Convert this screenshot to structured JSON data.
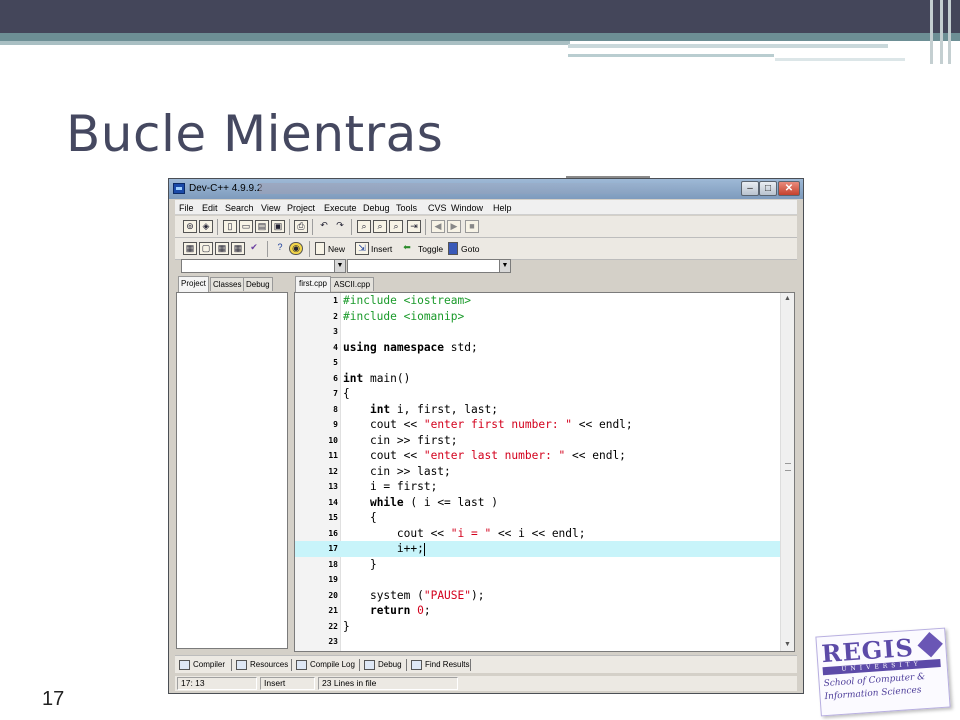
{
  "slide": {
    "title": "Bucle Mientras",
    "number": "17"
  },
  "window": {
    "title": "Dev-C++ 4.9.9.2",
    "buttons": {
      "minimize": "–",
      "maximize": "□",
      "close": "✕"
    }
  },
  "menu": [
    "File",
    "Edit",
    "Search",
    "View",
    "Project",
    "Execute",
    "Debug",
    "Tools",
    "CVS",
    "Window",
    "Help"
  ],
  "toolbar2": {
    "new_label": "New",
    "insert_label": "Insert",
    "toggle_label": "Toggle",
    "goto_label": "Goto"
  },
  "left_tabs": [
    "Project",
    "Classes",
    "Debug"
  ],
  "file_tabs": [
    "first.cpp",
    "ASCII.cpp"
  ],
  "code_lines": [
    {
      "n": "1"
    },
    {
      "n": "2"
    },
    {
      "n": "3"
    },
    {
      "n": "4"
    },
    {
      "n": "5"
    },
    {
      "n": "6"
    },
    {
      "n": "7"
    },
    {
      "n": "8"
    },
    {
      "n": "9"
    },
    {
      "n": "10"
    },
    {
      "n": "11"
    },
    {
      "n": "12"
    },
    {
      "n": "13"
    },
    {
      "n": "14"
    },
    {
      "n": "15"
    },
    {
      "n": "16"
    },
    {
      "n": "17"
    },
    {
      "n": "18"
    },
    {
      "n": "19"
    },
    {
      "n": "20"
    },
    {
      "n": "21"
    },
    {
      "n": "22"
    },
    {
      "n": "23"
    }
  ],
  "code": {
    "l1": "#include <iostream>",
    "l2": "#include <iomanip>",
    "l4_kw": "using namespace",
    "l4_rest": " std;",
    "l6_kw": "int",
    "l6_rest": " main()",
    "l7": "{",
    "l8_kw": "int",
    "l8_rest": " i, first, last;",
    "l9_a": "cout << ",
    "l9_str": "\"enter first number: \"",
    "l9_b": " << endl;",
    "l10": "cin >> first;",
    "l11_a": "cout << ",
    "l11_str": "\"enter last number: \"",
    "l11_b": " << endl;",
    "l12": "cin >> last;",
    "l13": "i = first;",
    "l14_kw": "while",
    "l14_rest": " ( i <= last )",
    "l15": "{",
    "l16_a": "cout << ",
    "l16_str": "\"i = \"",
    "l16_b": " << i << endl;",
    "l17": "i++;",
    "l18": "}",
    "l20_a": "system (",
    "l20_str": "\"PAUSE\"",
    "l20_b": ");",
    "l21_kw": "return",
    "l21_num": " 0",
    "l21_b": ";",
    "l22": "}"
  },
  "highlight_line": 17,
  "bottom_tabs": [
    "Compiler",
    "Resources",
    "Compile Log",
    "Debug",
    "Find Results"
  ],
  "status": {
    "position": "17: 13",
    "mode": "Insert",
    "lines": "23 Lines in file"
  },
  "logo": {
    "name": "REGIS",
    "university": "UNIVERSITY",
    "line1": "School of Computer &",
    "line2": "Information Sciences"
  },
  "colors": {
    "title": "#454860",
    "header_dark": "#44465a",
    "header_teal": "#6d8f95",
    "highlight": "#c8f4fa",
    "string": "#d3001c",
    "logo": "#5c4aa8"
  }
}
